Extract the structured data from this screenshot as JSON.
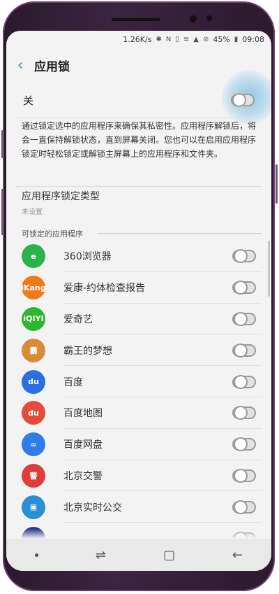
{
  "status_bar": {
    "net_speed": "1.26K/s",
    "battery": "45%",
    "time": "09:08"
  },
  "header": {
    "back_icon": "chevron-left-icon",
    "title": "应用锁"
  },
  "master": {
    "label": "关",
    "on": false
  },
  "description": "通过锁定选中的应用程序来确保其私密性。应用程序解锁后，将会一直保持解锁状态，直到屏幕关闭。您也可以在启用应用程序锁定时轻松锁定或解锁主屏幕上的应用程序和文件夹。",
  "lock_type": {
    "title": "应用程序锁定类型",
    "value": "未设置"
  },
  "section": {
    "title": "可锁定的应用程序"
  },
  "apps": [
    {
      "name": "360浏览器",
      "icon": "360-browser-icon",
      "icon_text": "e",
      "color": "#2bb24c",
      "on": false
    },
    {
      "name": "爱康-约体检查报告",
      "icon": "ikang-icon",
      "icon_text": "iKang",
      "color": "#f07a1a",
      "on": false
    },
    {
      "name": "爱奇艺",
      "icon": "iqiyi-icon",
      "icon_text": "iQIYI",
      "color": "#2fb52f",
      "on": false
    },
    {
      "name": "霸王的梦想",
      "icon": "game-icon",
      "icon_text": "霸",
      "color": "#d98b3a",
      "on": false
    },
    {
      "name": "百度",
      "icon": "baidu-icon",
      "icon_text": "du",
      "color": "#2d6ee0",
      "on": false
    },
    {
      "name": "百度地图",
      "icon": "baidu-map-icon",
      "icon_text": "du",
      "color": "#e54b3b",
      "on": false
    },
    {
      "name": "百度网盘",
      "icon": "baidu-netdisk-icon",
      "icon_text": "∞",
      "color": "#2f7ee8",
      "on": false
    },
    {
      "name": "北京交警",
      "icon": "beijing-police-icon",
      "icon_text": "警",
      "color": "#e23b3b",
      "on": false
    },
    {
      "name": "北京实时公交",
      "icon": "beijing-bus-icon",
      "icon_text": "▣",
      "color": "#2a8fd6",
      "on": false
    },
    {
      "name": "",
      "icon": "partial-app-icon",
      "icon_text": "",
      "color": "#2a3a8a",
      "on": false
    }
  ],
  "nav": {
    "recent_icon": "recent-apps-icon",
    "home_icon": "home-icon",
    "back_icon": "back-arrow-icon"
  }
}
